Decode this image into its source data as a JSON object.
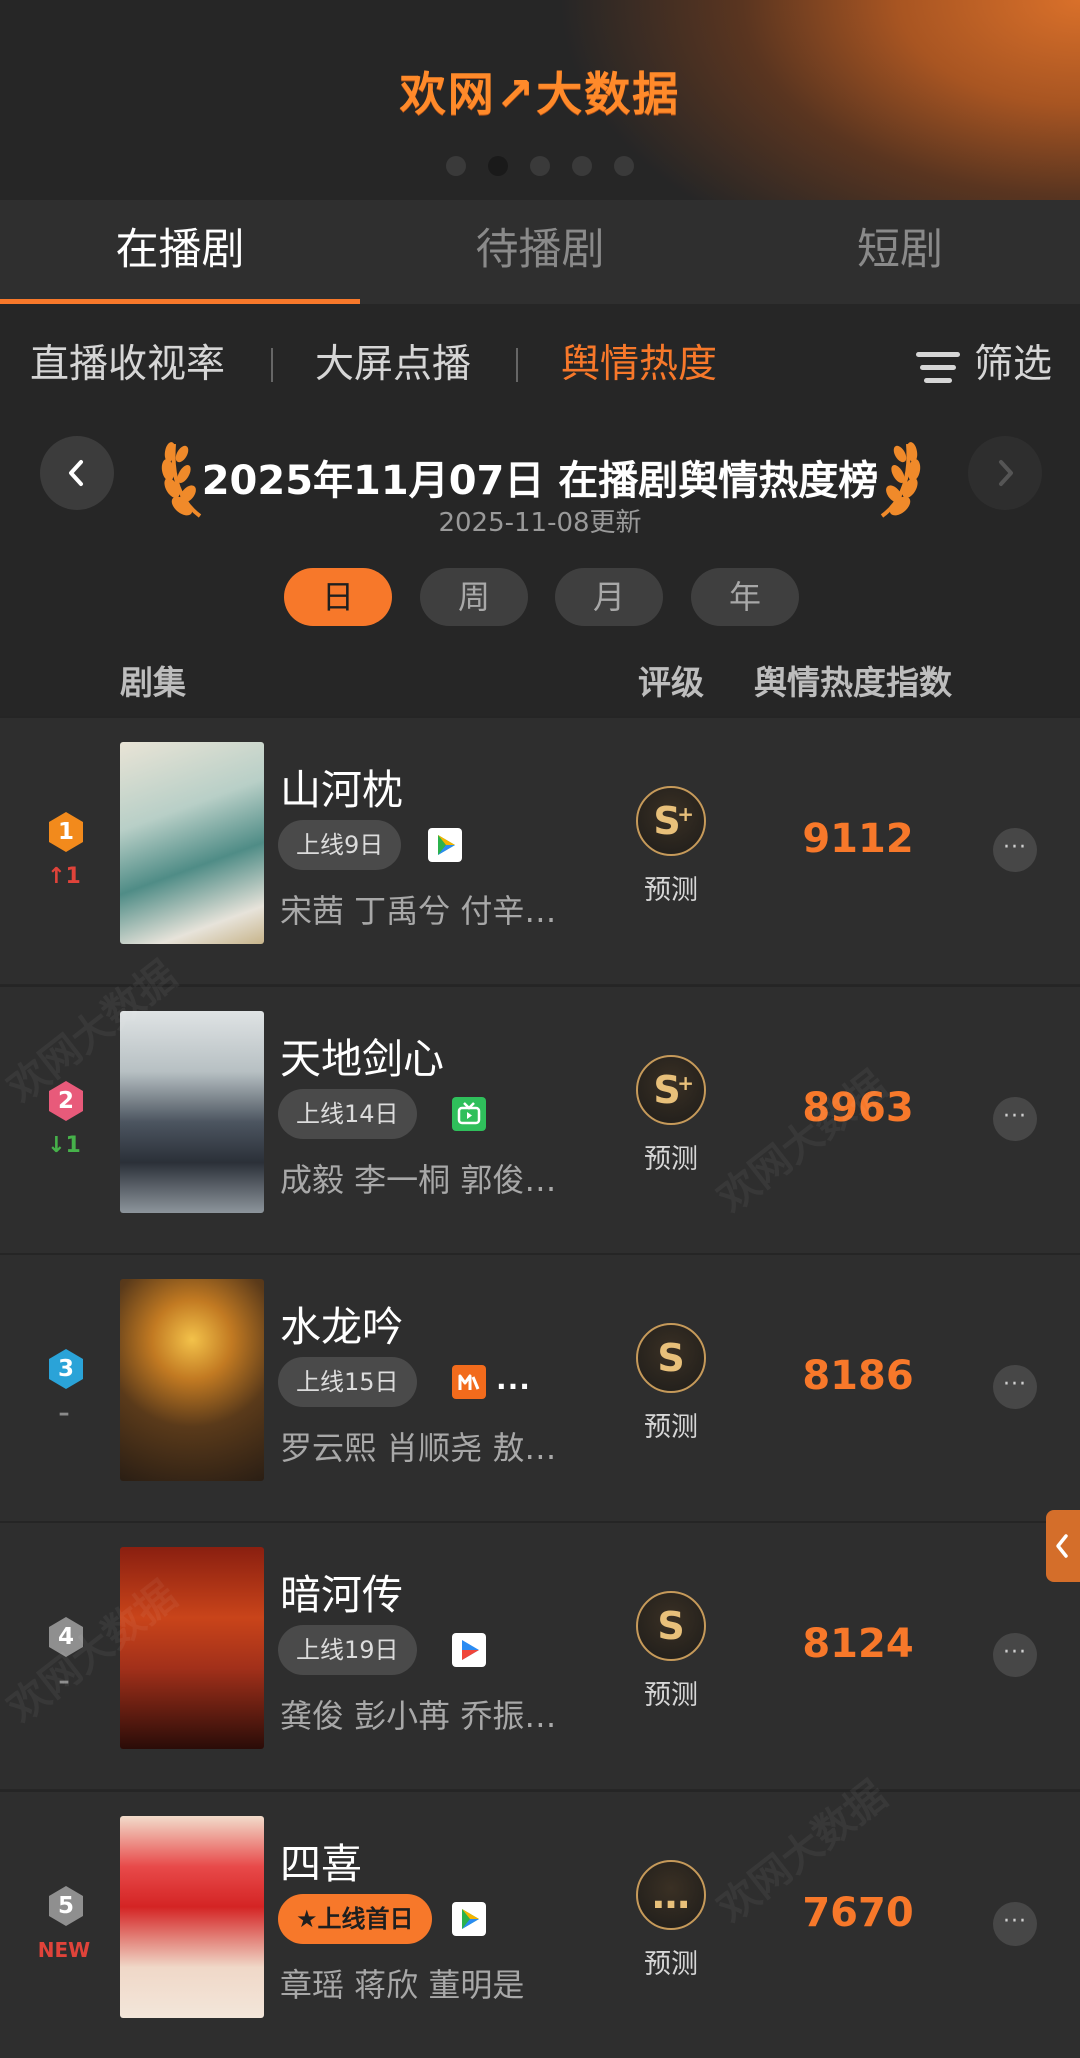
{
  "banner": {
    "brand": "欢网↗大数据",
    "page_index": 2,
    "page_count": 5
  },
  "main_tabs": [
    {
      "label": "在播剧",
      "active": true
    },
    {
      "label": "待播剧",
      "active": false
    },
    {
      "label": "短剧",
      "active": false
    }
  ],
  "sub_tabs": [
    {
      "label": "直播收视率",
      "active": false
    },
    {
      "label": "大屏点播",
      "active": false
    },
    {
      "label": "舆情热度",
      "active": true
    }
  ],
  "filter_label": "筛选",
  "board": {
    "title": "2025年11月07日 在播剧舆情热度榜",
    "updated": "2025-11-08更新"
  },
  "periods": [
    {
      "label": "日",
      "active": true
    },
    {
      "label": "周",
      "active": false
    },
    {
      "label": "月",
      "active": false
    },
    {
      "label": "年",
      "active": false
    }
  ],
  "columns": {
    "show": "剧集",
    "rating": "评级",
    "index": "舆情热度指数"
  },
  "rows": [
    {
      "rank": "1",
      "change": "↑1",
      "change_color": "#e0433a",
      "badge_color": "#f28a1c",
      "title": "山河枕",
      "online": "上线9日",
      "platform": "play-icon",
      "extra_platforms": "",
      "cast": "宋茜 丁禹兮 付辛…",
      "rating": "S",
      "rating_plus": "+",
      "rating_sub": "预测",
      "score": "9112"
    },
    {
      "rank": "2",
      "change": "↓1",
      "change_color": "#46b24a",
      "badge_color": "#e85a7a",
      "title": "天地剑心",
      "online": "上线14日",
      "platform": "tv-icon",
      "extra_platforms": "",
      "cast": "成毅 李一桐 郭俊…",
      "rating": "S",
      "rating_plus": "+",
      "rating_sub": "预测",
      "score": "8963"
    },
    {
      "rank": "3",
      "change": "–",
      "change_color": "#8a8a8a",
      "badge_color": "#2aa3d8",
      "title": "水龙吟",
      "online": "上线15日",
      "platform": "mango-icon",
      "extra_platforms": "...",
      "cast": "罗云熙 肖顺尧 敖…",
      "rating": "S",
      "rating_plus": "",
      "rating_sub": "预测",
      "score": "8186"
    },
    {
      "rank": "4",
      "change": "–",
      "change_color": "#8a8a8a",
      "badge_color": "#8f8f8f",
      "title": "暗河传",
      "online": "上线19日",
      "platform": "youku-icon",
      "extra_platforms": "",
      "cast": "龚俊 彭小苒 乔振…",
      "rating": "S",
      "rating_plus": "",
      "rating_sub": "预测",
      "score": "8124"
    },
    {
      "rank": "5",
      "change": "NEW",
      "change_color": "#e0433a",
      "badge_color": "#8f8f8f",
      "title": "四喜",
      "online": "★上线首日",
      "platform": "play-icon",
      "extra_platforms": "",
      "cast": "章瑶 蒋欣 董明是",
      "rating": "…",
      "rating_plus": "",
      "rating_sub": "预测",
      "score": "7670"
    }
  ]
}
